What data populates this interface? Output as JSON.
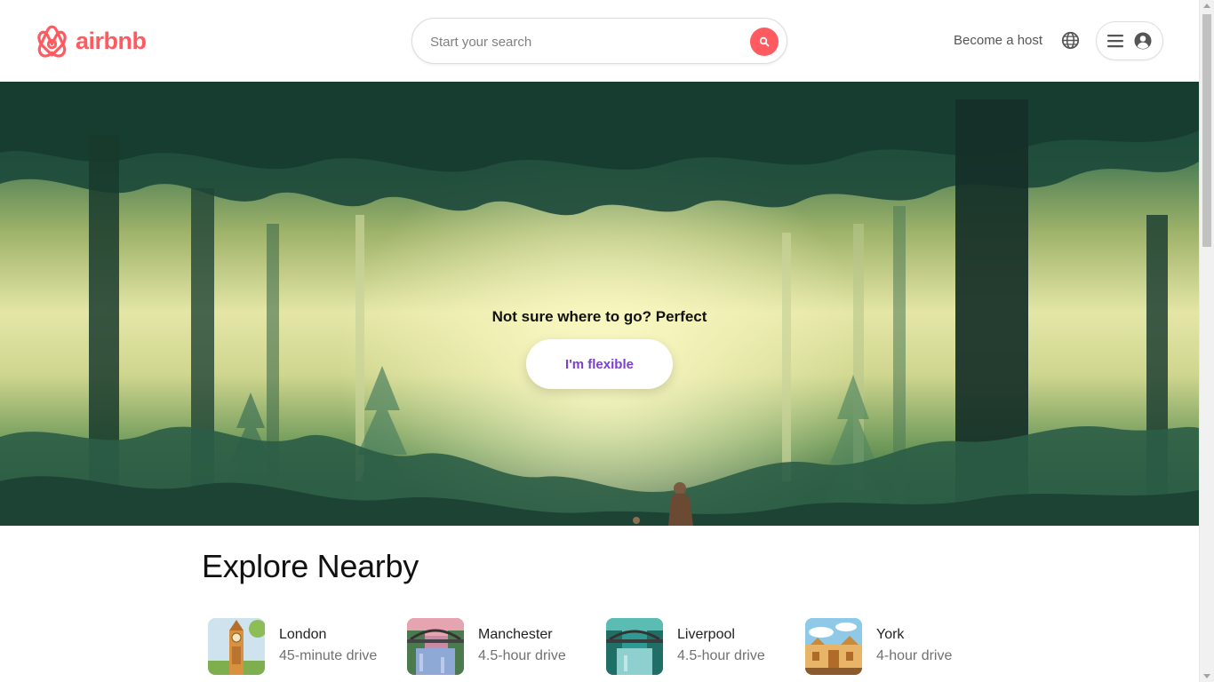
{
  "brand": {
    "name": "airbnb",
    "color": "#ff5a5f"
  },
  "search": {
    "placeholder": "Start your search",
    "button_icon": "search-icon"
  },
  "nav": {
    "become_host": "Become a host",
    "language_icon": "globe-icon",
    "menu_icon": "hamburger-icon",
    "profile_icon": "user-avatar-icon"
  },
  "hero": {
    "title": "Not sure where to go? Perfect",
    "button_label": "I'm flexible",
    "button_color": "#7b3fd0"
  },
  "explore": {
    "title": "Explore Nearby",
    "places": [
      {
        "name": "London",
        "distance": "45-minute drive"
      },
      {
        "name": "Manchester",
        "distance": "4.5-hour drive"
      },
      {
        "name": "Liverpool",
        "distance": "4.5-hour drive"
      },
      {
        "name": "York",
        "distance": "4-hour drive"
      }
    ]
  }
}
